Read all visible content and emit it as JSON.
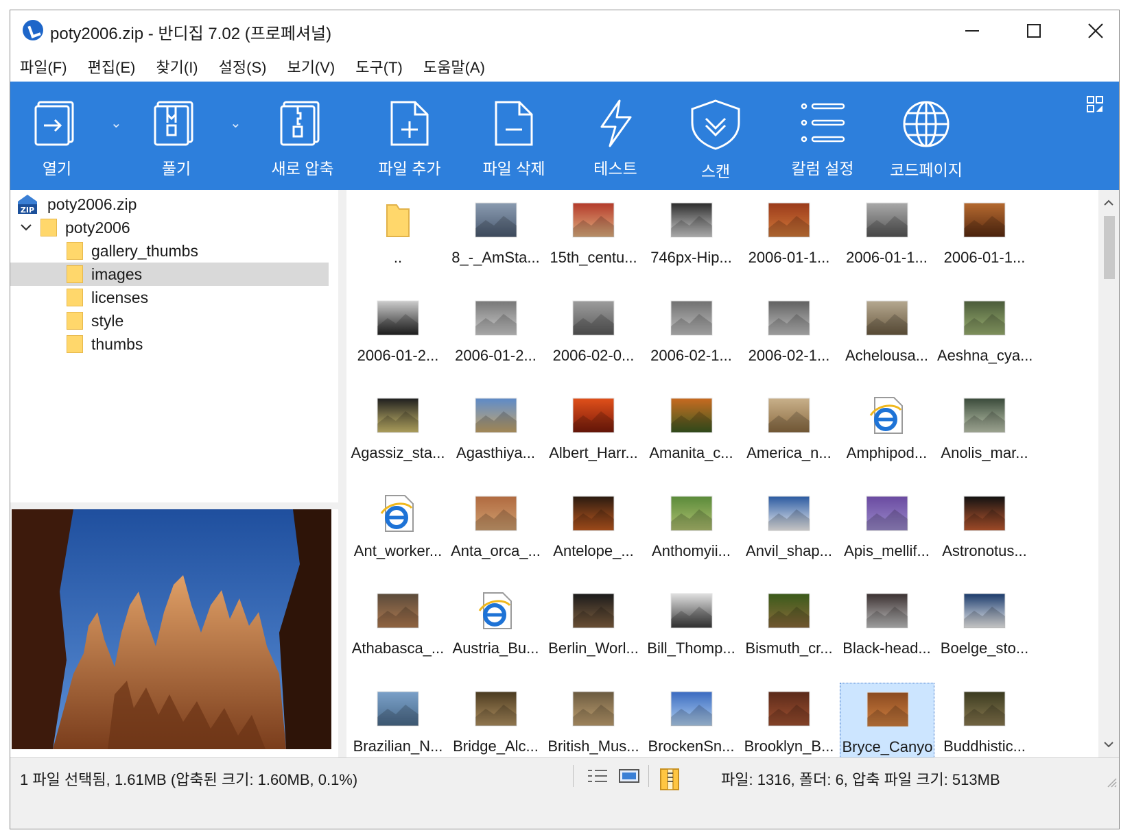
{
  "window": {
    "title": "poty2006.zip - 반디집 7.02 (프로페셔널)"
  },
  "menu": [
    "파일(F)",
    "편집(E)",
    "찾기(I)",
    "설정(S)",
    "보기(V)",
    "도구(T)",
    "도움말(A)"
  ],
  "toolbar": {
    "open": "열기",
    "extract": "풀기",
    "new_archive": "새로 압축",
    "add_files": "파일 추가",
    "delete_files": "파일 삭제",
    "test": "테스트",
    "scan": "스캔",
    "column_settings": "칼럼 설정",
    "codepage": "코드페이지"
  },
  "tree": {
    "root": "poty2006.zip",
    "folder": "poty2006",
    "children": [
      "gallery_thumbs",
      "images",
      "licenses",
      "style",
      "thumbs"
    ],
    "selected": "images"
  },
  "files": [
    "..",
    "8_-_AmSta...",
    "15th_centu...",
    "746px-Hip...",
    "2006-01-1...",
    "2006-01-1...",
    "2006-01-1...",
    "2006-01-2...",
    "2006-01-2...",
    "2006-02-0...",
    "2006-02-1...",
    "2006-02-1...",
    "Achelousa...",
    "Aeshna_cya...",
    "Agassiz_sta...",
    "Agasthiya...",
    "Albert_Harr...",
    "Amanita_c...",
    "America_n...",
    "Amphipod...",
    "Anolis_mar...",
    "Ant_worker...",
    "Anta_orca_...",
    "Antelope_...",
    "Anthomyii...",
    "Anvil_shap...",
    "Apis_mellif...",
    "Astronotus...",
    "Athabasca_...",
    "Austria_Bu...",
    "Berlin_Worl...",
    "Bill_Thomp...",
    "Bismuth_cr...",
    "Black-head...",
    "Boelge_sto...",
    "Brazilian_N...",
    "Bridge_Alc...",
    "British_Mus...",
    "BrockenSn...",
    "Brooklyn_B...",
    "Bryce_Canyo",
    "Buddhistic..."
  ],
  "selected_file_index": 40,
  "icon_kinds": {
    "0": "folder-icon",
    "19": "html-file-icon",
    "21": "html-file-icon",
    "29": "html-file-icon"
  },
  "status": {
    "left": "1 파일 선택됨, 1.61MB (압축된 크기: 1.60MB, 0.1%)",
    "right": "파일: 1316, 폴더: 6, 압축 파일 크기: 513MB"
  },
  "colors": {
    "toolbar": "#2d7fdc",
    "selection": "#cce5ff",
    "tree_selection": "#d9d9d9"
  }
}
